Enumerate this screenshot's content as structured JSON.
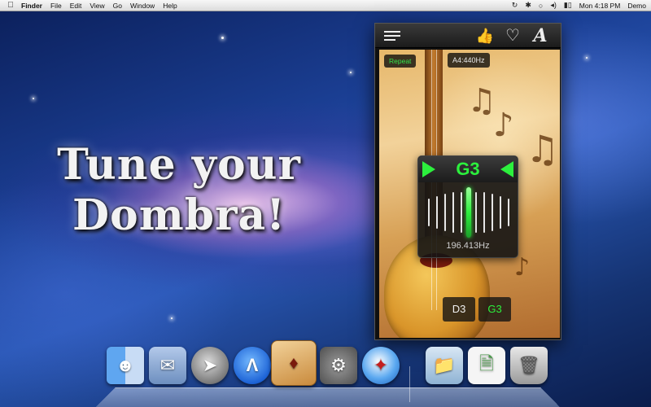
{
  "menubar": {
    "apple_icon": "apple-icon",
    "app_name": "Finder",
    "menus": [
      "File",
      "Edit",
      "View",
      "Go",
      "Window",
      "Help"
    ],
    "status_icons": [
      "time-machine-icon",
      "bluetooth-icon",
      "wifi-icon",
      "volume-icon",
      "battery-icon"
    ],
    "clock": "Mon 4:18 PM",
    "user": "Demo"
  },
  "headline": {
    "line1": "Tune your",
    "line2": "Dombra!"
  },
  "app": {
    "toolbar_icons": [
      "menu-icon",
      "like-icon",
      "heart-icon",
      "font-icon"
    ],
    "font_icon_glyph": "A",
    "repeat_label": "Repeat",
    "reference_pitch": "A4:440Hz",
    "tuner": {
      "note": "G3",
      "frequency": "196.413Hz"
    },
    "strings": [
      "D3",
      "G3"
    ],
    "selected_string": "G3",
    "accent_color": "#2cf03d"
  },
  "dock": {
    "items": [
      "finder-icon",
      "mail-icon",
      "launchpad-icon",
      "app-store-icon",
      "dombra-tuner-icon",
      "system-preferences-icon",
      "safari-icon",
      "documents-folder-icon",
      "document-stack-icon",
      "trash-icon"
    ]
  }
}
